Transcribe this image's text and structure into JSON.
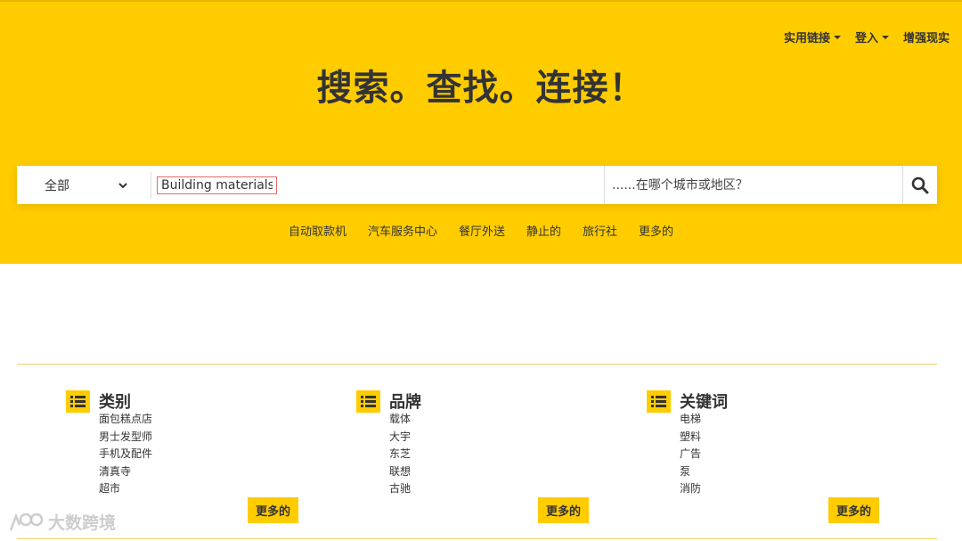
{
  "topnav": {
    "links": "实用链接",
    "login": "登入",
    "ar": "增强现实"
  },
  "headline": "搜索。查找。连接！",
  "search": {
    "category_selected": "全部",
    "keyword_value": "Building materials",
    "location_placeholder": "......在哪个城市或地区？"
  },
  "quicklinks": [
    "自动取款机",
    "汽车服务中心",
    "餐厅外送",
    "静止的",
    "旅行社",
    "更多的"
  ],
  "columns": [
    {
      "title": "类别",
      "items": [
        "面包糕点店",
        "男士发型师",
        "手机及配件",
        "清真寺",
        "超市"
      ],
      "more": "更多的"
    },
    {
      "title": "品牌",
      "items": [
        "载体",
        "大宇",
        "东芝",
        "联想",
        "古驰"
      ],
      "more": "更多的"
    },
    {
      "title": "关键词",
      "items": [
        "电梯",
        "塑料",
        "广告",
        "泵",
        "消防"
      ],
      "more": "更多的"
    }
  ],
  "watermark": "大数跨境",
  "colors": {
    "brand": "#ffcc00",
    "text": "#333333"
  }
}
